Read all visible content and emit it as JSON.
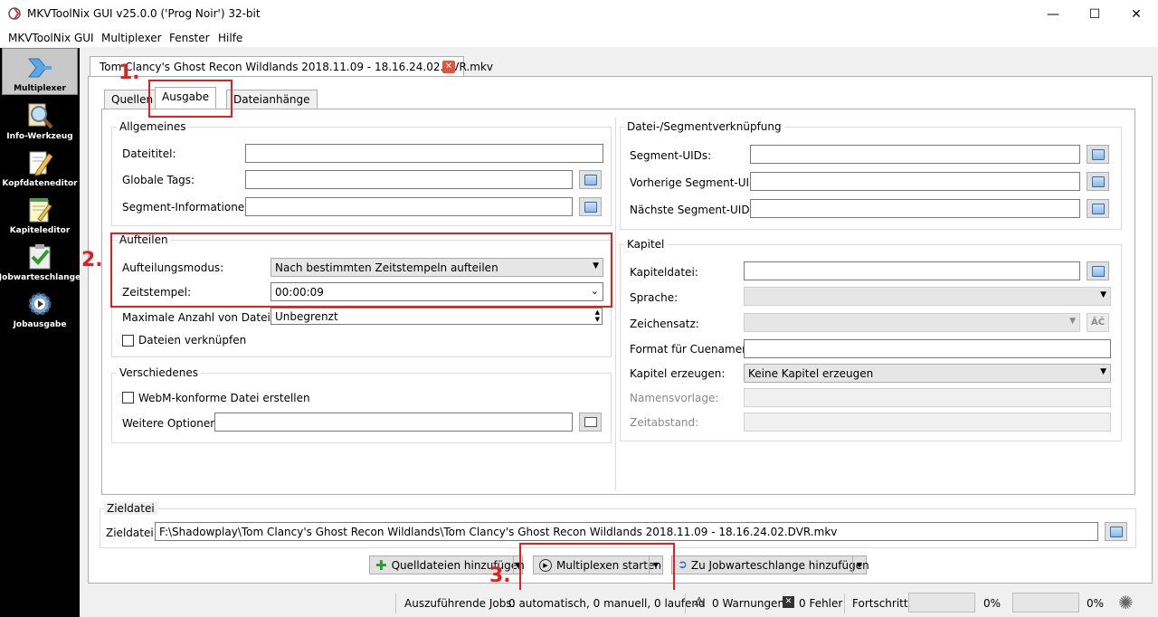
{
  "window": {
    "title": "MKVToolNix GUI v25.0.0 ('Prog Noir') 32-bit",
    "minimize": "—",
    "maximize": "☐",
    "close": "✕"
  },
  "menu": [
    "MKVToolNix GUI",
    "Multiplexer",
    "Fenster",
    "Hilfe"
  ],
  "sidebar": {
    "items": [
      {
        "label": "Multiplexer",
        "icon": "multiplexer-icon",
        "active": true
      },
      {
        "label": "Info-Werkzeug",
        "icon": "magnifier-icon"
      },
      {
        "label": "Kopfdateneditor",
        "icon": "pencil-icon"
      },
      {
        "label": "Kapiteleditor",
        "icon": "notepad-icon"
      },
      {
        "label": "Jobwarteschlange",
        "icon": "checklist-icon"
      },
      {
        "label": "Jobausgabe",
        "icon": "gear-icon"
      }
    ]
  },
  "doc_tab": {
    "label": "Tom Clancy's Ghost Recon  Wildlands 2018.11.09 - 18.16.24.02.DVR.mkv",
    "close": "✕"
  },
  "inner_tabs": [
    "Quellen",
    "Ausgabe",
    "Dateianhänge"
  ],
  "general": {
    "title": "Allgemeines",
    "file_title_label": "Dateititel:",
    "file_title_value": "",
    "global_tags_label": "Globale Tags:",
    "global_tags_value": "",
    "segment_info_label": "Segment-Informationen:",
    "segment_info_value": ""
  },
  "split": {
    "title": "Aufteilen",
    "mode_label": "Aufteilungsmodus:",
    "mode_value": "Nach bestimmten Zeitstempeln aufteilen",
    "timestamps_label": "Zeitstempel:",
    "timestamps_value": "00:00:09",
    "max_files_label": "Maximale Anzahl von Dateien:",
    "max_files_value": "Unbegrenzt",
    "link_files_label": "Dateien verknüpfen"
  },
  "misc": {
    "title": "Verschiedenes",
    "webm_label": "WebM-konforme Datei erstellen",
    "more_options_label": "Weitere Optionen:",
    "more_options_value": ""
  },
  "segment_linking": {
    "title": "Datei-/Segmentverknüpfung",
    "segment_uids_label": "Segment-UIDs:",
    "prev_uid_label": "Vorherige Segment-UID:",
    "next_uid_label": "Nächste Segment-UID:"
  },
  "chapters": {
    "title": "Kapitel",
    "file_label": "Kapiteldatei:",
    "file_value": "",
    "language_label": "Sprache:",
    "language_value": "",
    "charset_label": "Zeichensatz:",
    "charset_value": "",
    "cue_format_label": "Format für Cuenamen:",
    "cue_format_value": "",
    "generate_label": "Kapitel erzeugen:",
    "generate_value": "Keine Kapitel erzeugen",
    "name_template_label": "Namensvorlage:",
    "interval_label": "Zeitabstand:"
  },
  "destination": {
    "title": "Zieldatei",
    "label": "Zieldatei:",
    "value": "F:\\Shadowplay\\Tom Clancy's Ghost Recon  Wildlands\\Tom Clancy's Ghost Recon  Wildlands 2018.11.09 - 18.16.24.02.DVR.mkv"
  },
  "actions": {
    "add_sources": "Quelldateien hinzufügen",
    "start_mux": "Multiplexen starten",
    "add_queue": "Zu Jobwarteschlange hinzufügen"
  },
  "annotations": [
    "1.",
    "2.",
    "3."
  ],
  "status": {
    "jobs_label": "Auszuführende Jobs:",
    "jobs_value": "0 automatisch, 0 manuell, 0 laufend",
    "warnings": "0 Warnungen",
    "errors": "0 Fehler",
    "progress_label": "Fortschritt:",
    "progress1": "0%",
    "progress2": "0%",
    "progress1_fraction": 0,
    "progress2_fraction": 0
  },
  "colors": {
    "annotation": "#e02020",
    "sidebar_bg": "#000000"
  }
}
